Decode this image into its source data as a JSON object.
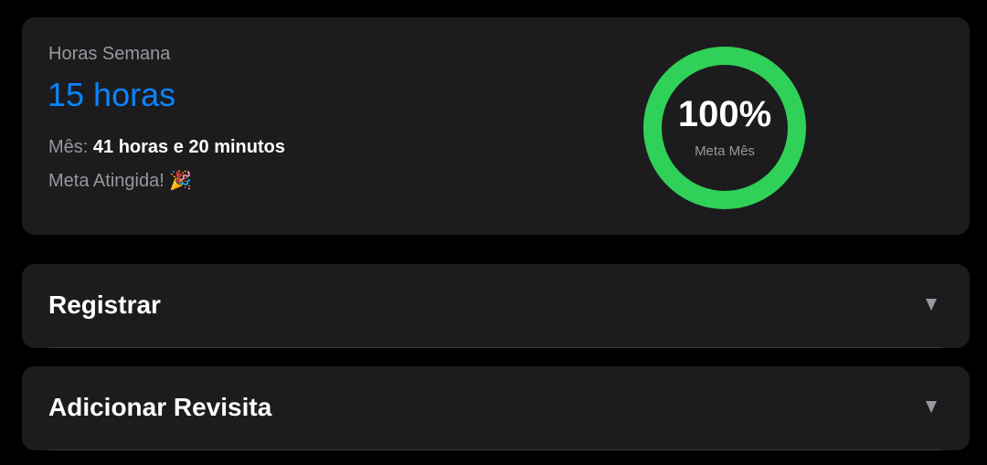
{
  "stats": {
    "week_label": "Horas Semana",
    "week_value": "15 horas",
    "month_label": "Mês:",
    "month_value": "41 horas e 20 minutos",
    "goal_status": "Meta Atingida! 🎉"
  },
  "ring": {
    "percent_text": "100%",
    "caption": "Meta Mês",
    "progress": 1.0,
    "color": "#30d158",
    "track_color": "#2c2c2e"
  },
  "sections": [
    {
      "title": "Registrar"
    },
    {
      "title": "Adicionar Revisita"
    }
  ],
  "colors": {
    "background": "#000000",
    "card": "#1c1c1e",
    "accent": "#0a84ff",
    "secondary_text": "#98989d",
    "primary_text": "#ffffff"
  },
  "icons": {
    "party": "party-popper-icon",
    "expand": "chevron-down-icon"
  }
}
